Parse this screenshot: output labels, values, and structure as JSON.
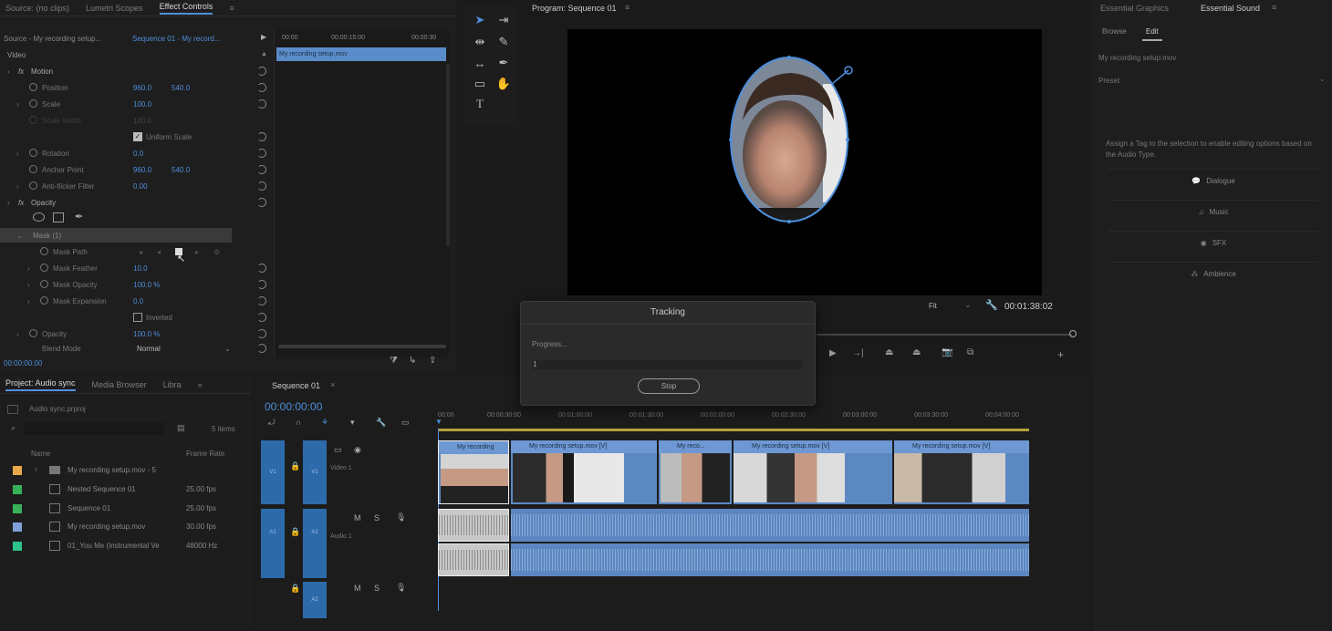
{
  "effect_controls": {
    "tabs": [
      "Source: (no clips)",
      "Lumetri Scopes",
      "Effect Controls"
    ],
    "source_label": "Source - My recording setup...",
    "sequence_label": "Sequence 01 - My record...",
    "timecodes": [
      "00:00",
      "00:00:15:00",
      "00:00:30"
    ],
    "clip_name": "My recording setup.mov",
    "video_header": "Video",
    "rows": {
      "motion": "Motion",
      "position": {
        "label": "Position",
        "v1": "960.0",
        "v2": "540.0"
      },
      "scale": {
        "label": "Scale",
        "v1": "100.0"
      },
      "scale_width": {
        "label": "Scale Width",
        "v1": "100.0"
      },
      "uniform_scale": "Uniform Scale",
      "rotation": {
        "label": "Rotation",
        "v1": "0.0"
      },
      "anchor": {
        "label": "Anchor Point",
        "v1": "960.0",
        "v2": "540.0"
      },
      "flicker": {
        "label": "Anti-flicker Filter",
        "v1": "0.00"
      },
      "opacity_header": "Opacity",
      "mask": "Mask (1)",
      "mask_path": "Mask Path",
      "mask_feather": {
        "label": "Mask Feather",
        "v1": "10.0"
      },
      "mask_opacity": {
        "label": "Mask Opacity",
        "v1": "100.0 %"
      },
      "mask_expansion": {
        "label": "Mask Expansion",
        "v1": "0.0"
      },
      "inverted": "Inverted",
      "opacity": {
        "label": "Opacity",
        "v1": "100.0 %"
      },
      "blend": {
        "label": "Blend Mode",
        "v1": "Normal"
      }
    },
    "footer_time": "00:00:00:00"
  },
  "program": {
    "tab": "Program: Sequence 01",
    "fit": "Fit",
    "timecode": "00:01:38:02"
  },
  "tracking_dialog": {
    "title": "Tracking",
    "progress_label": "Progress...",
    "progress_value": "1",
    "stop_label": "Stop"
  },
  "essential": {
    "tabs": [
      "Essential Graphics",
      "Essential Sound"
    ],
    "subtabs": [
      "Browse",
      "Edit"
    ],
    "clip_name": "My recording setup.mov",
    "preset_label": "Preset",
    "assign_text": "Assign a Tag to the selection to enable editing options based on the Audio Type.",
    "types": [
      "Dialogue",
      "Music",
      "SFX",
      "Ambience"
    ]
  },
  "project": {
    "tabs": [
      "Project: Audio sync",
      "Media Browser",
      "Libra"
    ],
    "file": "Audio sync.prproj",
    "items_count": "5 items",
    "col_name": "Name",
    "col_rate": "Frame Rate",
    "items": [
      {
        "name": "My recording setup.mov - 5",
        "rate": "",
        "color": "#e8a84a"
      },
      {
        "name": "Nested Sequence 01",
        "rate": "25.00 fps",
        "color": "#38b25a"
      },
      {
        "name": "Sequence 01",
        "rate": "25.00 fps",
        "color": "#38b25a"
      },
      {
        "name": "My recording setup.mov",
        "rate": "30.00 fps",
        "color": "#7f9fd8"
      },
      {
        "name": "01_You Me (Instrumental Ve",
        "rate": "48000 Hz",
        "color": "#2fc28a"
      }
    ]
  },
  "timeline": {
    "tab": "Sequence 01",
    "timecode": "00:00:00:00",
    "ruler": [
      "00:00",
      "00:00:30:00",
      "00:01:00:00",
      "00:01:30:00",
      "00:02:00:00",
      "00:02:30:00",
      "00:03:00:00",
      "00:03:30:00",
      "00:04:00:00"
    ],
    "tracks": {
      "v1": "V1",
      "a1": "A1",
      "a2": "A2",
      "video1": "Video 1",
      "audio1": "Audio 1"
    },
    "clips": [
      "My recording",
      "My recording setup.mov [V]",
      "My reco...",
      "My recording setup.mov [V]",
      "My recording setup.mov [V]"
    ]
  },
  "accent": "#4f8fdb"
}
